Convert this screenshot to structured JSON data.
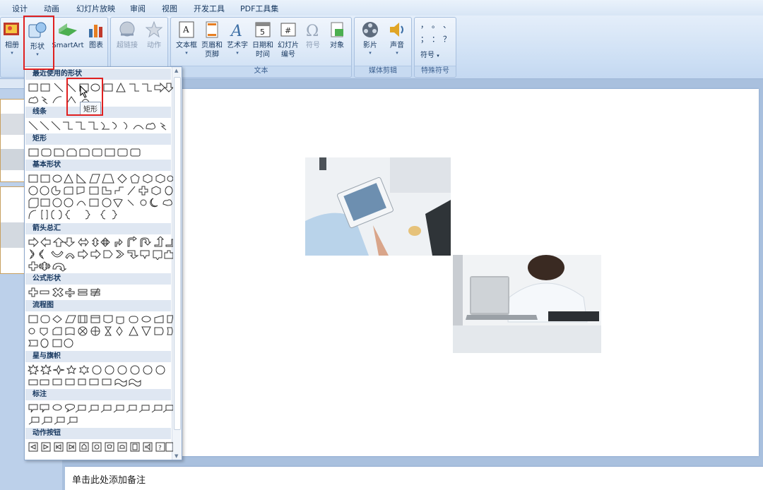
{
  "menu_tabs": [
    "设计",
    "动画",
    "幻灯片放映",
    "审阅",
    "视图",
    "开发工具",
    "PDF工具集"
  ],
  "ribbon": {
    "album_label": "相册",
    "shapes_label": "形状",
    "smartart_label": "SmartArt",
    "chart_label": "图表",
    "hyperlink_label": "超链接",
    "action_label": "动作",
    "textbox_label": "文本框",
    "header_footer_label": [
      "页眉和",
      "页脚"
    ],
    "wordart_label": "艺术字",
    "datetime_label": [
      "日期和",
      "时间"
    ],
    "slide_number_label": [
      "幻灯片",
      "编号"
    ],
    "symbol_label": "符号",
    "object_label": "对象",
    "text_group": "文本",
    "movie_label": "影片",
    "sound_label": "声音",
    "media_group": "媒体剪辑",
    "symbol2_label": "符号",
    "special_group": "特殊符号",
    "special_symbols": [
      "，",
      "。",
      "、",
      "；",
      "：",
      "？"
    ]
  },
  "dropdown": {
    "sections": [
      "最近使用的形状",
      "线条",
      "矩形",
      "基本形状",
      "箭头总汇",
      "公式形状",
      "流程图",
      "星与旗帜",
      "标注",
      "动作按钮"
    ]
  },
  "tooltip": "矩形",
  "notes": "单击此处添加备注",
  "colors": {
    "highlight": "#e02020",
    "ribbon_bg": "#dbe8f7",
    "workspace": "#a9c0de"
  }
}
